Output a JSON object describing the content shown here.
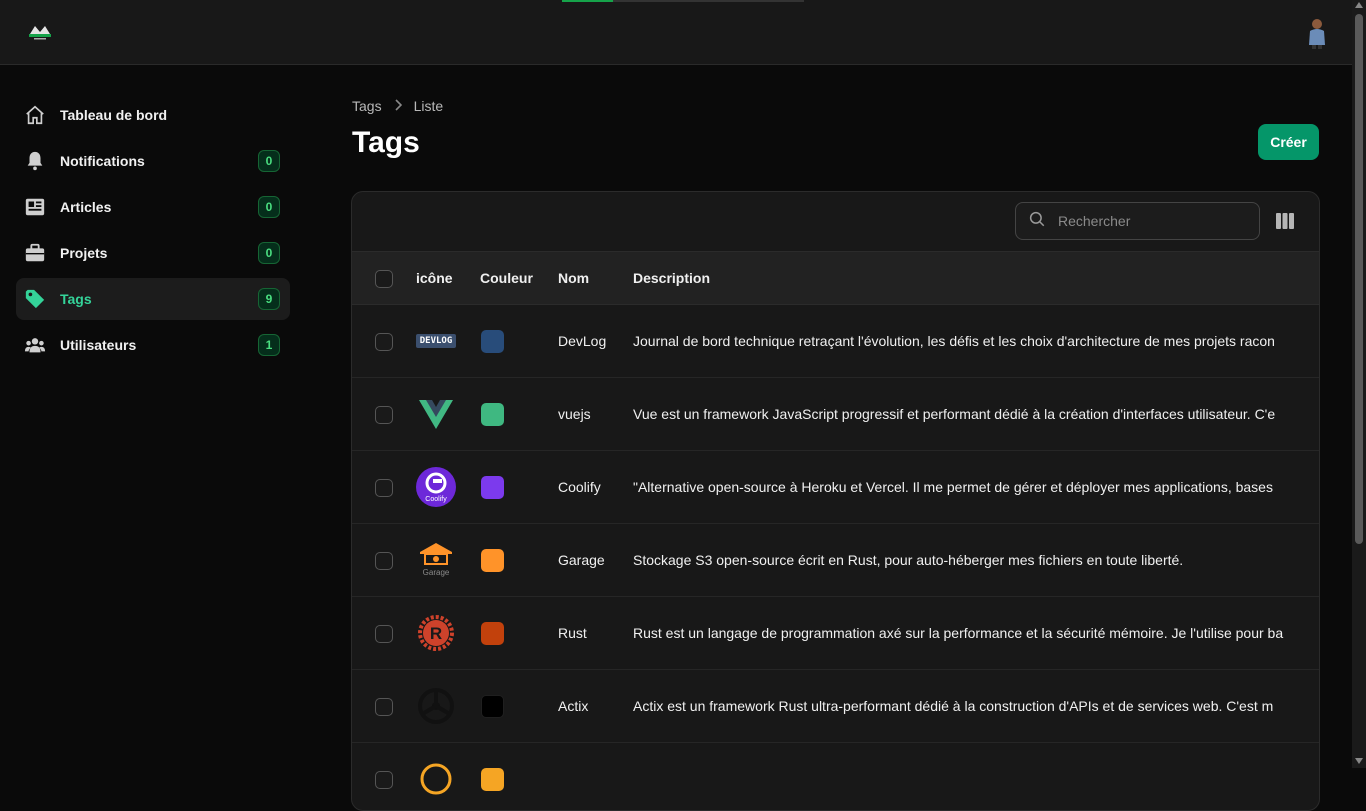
{
  "topbar": {
    "progress": 0.21
  },
  "sidebar": {
    "items": [
      {
        "label": "Tableau de bord",
        "badge": null
      },
      {
        "label": "Notifications",
        "badge": "0"
      },
      {
        "label": "Articles",
        "badge": "0"
      },
      {
        "label": "Projets",
        "badge": "0"
      },
      {
        "label": "Tags",
        "badge": "9"
      },
      {
        "label": "Utilisateurs",
        "badge": "1"
      }
    ],
    "active": "Tags"
  },
  "breadcrumb": {
    "root": "Tags",
    "current": "Liste"
  },
  "page": {
    "title": "Tags",
    "create_label": "Créer"
  },
  "search": {
    "placeholder": "Rechercher"
  },
  "table": {
    "columns": [
      "icône",
      "Couleur",
      "Nom",
      "Description"
    ],
    "rows": [
      {
        "icon": "devlog-logo-icon",
        "icon_text": "DEVLOG",
        "color": "#284c7a",
        "name": "DevLog",
        "description": "Journal de bord technique retraçant l'évolution, les défis et les choix d'architecture de mes projets racon"
      },
      {
        "icon": "vuejs-logo-icon",
        "color": "#3fb881",
        "name": "vuejs",
        "description": "Vue est un framework JavaScript progressif et performant dédié à la création d'interfaces utilisateur. C'e"
      },
      {
        "icon": "coolify-logo-icon",
        "icon_text": "Coolify",
        "color": "#7c3aed",
        "name": "Coolify",
        "description": "\"Alternative open-source à Heroku et Vercel. Il me permet de gérer et déployer mes applications, bases"
      },
      {
        "icon": "garage-logo-icon",
        "icon_text": "Garage",
        "color": "#ff9329",
        "name": "Garage",
        "description": "Stockage S3 open-source écrit en Rust, pour auto-héberger mes fichiers en toute liberté."
      },
      {
        "icon": "rust-logo-icon",
        "color": "#c2410c",
        "name": "Rust",
        "description": "Rust est un langage de programmation axé sur la performance et la sécurité mémoire. Je l'utilise pour ba"
      },
      {
        "icon": "actix-logo-icon",
        "color": "#000000",
        "name": "Actix",
        "description": "Actix est un framework Rust ultra-performant dédié à la construction d'APIs et de services web. C'est m"
      },
      {
        "icon": "partial-logo-icon",
        "color": "#f5a524",
        "name": "",
        "description": ""
      }
    ]
  }
}
